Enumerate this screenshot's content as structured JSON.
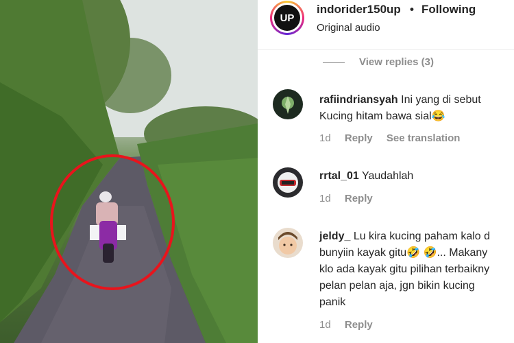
{
  "post": {
    "username": "indorider150up",
    "separator": "•",
    "follow_status": "Following",
    "audio": "Original audio",
    "logo_text": "UP"
  },
  "view_replies": "View replies (3)",
  "comments": [
    {
      "username": "rafiindriansyah",
      "lines": [
        "Ini yang di sebut",
        "Kucing hitam bawa sial😂"
      ],
      "time": "1d",
      "reply": "Reply",
      "translate": "See translation"
    },
    {
      "username": "rrtal_01",
      "lines": [
        "Yaudahlah"
      ],
      "time": "1d",
      "reply": "Reply"
    },
    {
      "username": "jeldy_",
      "lines": [
        "Lu kira kucing paham kalo d",
        "bunyiin kayak gitu🤣 🤣... Makany",
        "klo ada kayak gitu pilihan terbaikny",
        "pelan pelan aja, jgn bikin kucing",
        "panik"
      ],
      "time": "1d",
      "reply": "Reply"
    }
  ],
  "colors": {
    "highlight_circle": "#e8141c",
    "muted_text": "#8e8e8e"
  }
}
